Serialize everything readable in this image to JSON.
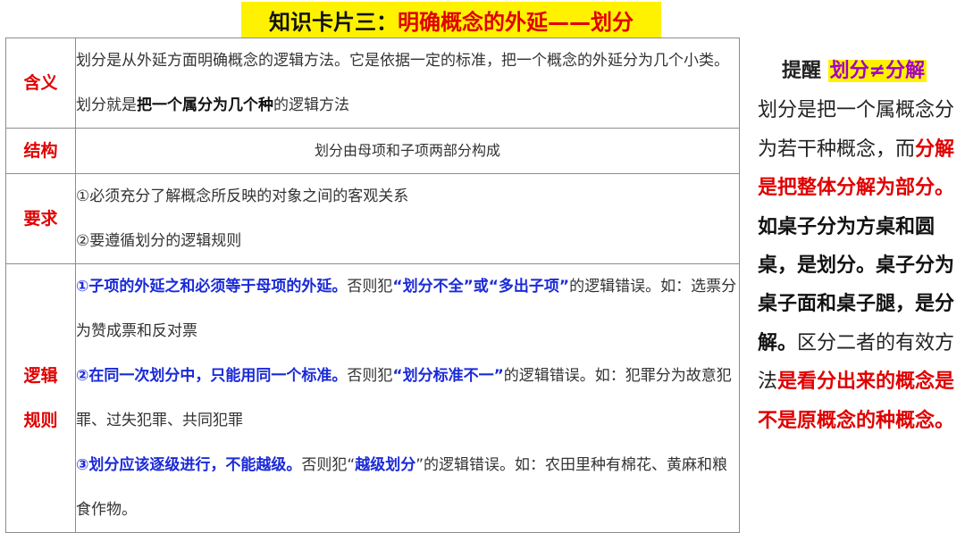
{
  "title": {
    "prefix": "知识卡片三：",
    "main": "明确概念的外延——",
    "highlight": "划分"
  },
  "rows": {
    "meaning": {
      "label": "含义",
      "text1": "划分是从外延方面明确概念的逻辑方法。它是依据一定的标准，把一个概念的外延分为几个小类。划分就是",
      "bold": "把一个属分为几个种",
      "text2": "的逻辑方法"
    },
    "structure": {
      "label": "结构",
      "text": "划分由母项和子项两部分构成"
    },
    "requirement": {
      "label": "要求",
      "items": [
        "①必须充分了解概念所反映的对象之间的客观关系",
        "②要遵循划分的逻辑规则"
      ]
    },
    "rules": {
      "label_line1": "逻辑",
      "label_line2": "规则",
      "r1_bold": "①子项的外延之和必须等于母项的外延。",
      "r1_a": "否则犯",
      "r1_b": "“划分不全”或“多出子项”",
      "r1_c": "的逻辑错误。如：选票分为赞成票和反对票",
      "r2_bold": "②在同一次划分中，只能用同一个标准。",
      "r2_a": "否则犯",
      "r2_b": "“划分标准不一”",
      "r2_c": "的逻辑错误。如：犯罪分为故意犯罪、过失犯罪、共同犯罪",
      "r3_bold": "③划分应该逐级进行，不能越级。",
      "r3_a": "否则犯“",
      "r3_b": "越级划分",
      "r3_c": "”的逻辑错误。如：农田里种有棉花、黄麻和粮食作物。"
    }
  },
  "side": {
    "head_label": "提醒",
    "head_tag": "划分≠分解",
    "p1": "划分是把一个属概念分为若干种概念，而",
    "p2_red": "分解是把整体分解为部分。",
    "p3_bold": "如桌子分为方桌和圆桌，是划分。桌子分为桌子面和桌子腿，是分解。",
    "p4": "区分二者的有效方法",
    "p5_red": "是看分出来的概念是不是原概念的种概念。"
  },
  "colors": {
    "highlight_bg": "#fff200",
    "red": "#e00000",
    "blue": "#1a2ad8",
    "purple": "#a000c8"
  }
}
